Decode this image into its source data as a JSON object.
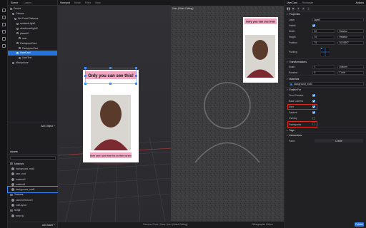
{
  "rail": {
    "icons": [
      "scene-icon",
      "layers-icon",
      "camera-icon",
      "script-icon",
      "asset-icon",
      "settings-icon"
    ]
  },
  "scene_panel": {
    "tabs": [
      "Scene",
      "Layers"
    ],
    "tree": [
      "Device",
      "Camera",
      "Set Focal Distance",
      "ambientLight0",
      "directionalLight0",
      "planeA0",
      "user",
      "ParticipantCard",
      "ParticipantText",
      "UserCard",
      "UserText",
      "Microphone"
    ],
    "selected_index": 9,
    "add_object_label": "Add Object +"
  },
  "assets": {
    "title": "Assets",
    "items": [
      {
        "label": "Materials",
        "kind": "group"
      },
      {
        "label": "background_mat1",
        "kind": "material"
      },
      {
        "label": "user_mat",
        "kind": "material"
      },
      {
        "label": "material0",
        "kind": "material"
      },
      {
        "label": "material1",
        "kind": "material"
      },
      {
        "label": "background_mat0",
        "kind": "material",
        "highlighted": true
      },
      {
        "label": "Textures",
        "kind": "group"
      },
      {
        "label": "cameraTexture0",
        "kind": "texture"
      },
      {
        "label": "nullLayout",
        "kind": "texture"
      },
      {
        "label": "Script",
        "kind": "group"
      },
      {
        "label": "script.js",
        "kind": "script"
      }
    ],
    "add_asset_label": "Add Asset +"
  },
  "viewport": {
    "tabs": [
      "Viewport",
      "Mode",
      "Filter",
      "View"
    ],
    "card_top_text": "Only you can see this!",
    "card_bottom_text": "Both users can view this on their screen"
  },
  "camera_view": {
    "title": "User (Video Calling)",
    "card_text": "Only you can see this!",
    "footer_left": "Camera: Front | View: User (Video Calling)",
    "footer_right": "Orthographic 100cm"
  },
  "inspector": {
    "title": "UserCard",
    "subtitle": "— Rectangle",
    "actions_label": "Actions",
    "sections": {
      "properties": "Properties",
      "transformations": "Transformations",
      "materials": "Materials",
      "enable_for": "Enable For",
      "tags": "Tags",
      "interactions": "Interactions"
    },
    "properties": [
      {
        "label": "Layer",
        "value": "layer0"
      },
      {
        "label": "Visible",
        "value": ""
      },
      {
        "label": "Width",
        "value": "92",
        "unit": "Relative"
      },
      {
        "label": "Height",
        "value": "70",
        "unit": "Relative"
      },
      {
        "label": "Position",
        "value": "74",
        "unit": "16.08397"
      },
      {
        "label": "Pivoting",
        "value": ""
      }
    ],
    "transformations": [
      {
        "label": "Scale",
        "value": "1",
        "unit": "Uniform"
      },
      {
        "label": "Rotation",
        "value": "0",
        "unit": "Z Axis"
      }
    ],
    "material_value": "background_mat0",
    "enable_for": [
      {
        "label": "Front Camera",
        "checked": true,
        "highlighted": false
      },
      {
        "label": "Back Camera",
        "checked": true,
        "highlighted": false
      },
      {
        "label": "User",
        "checked": true,
        "highlighted": true
      },
      {
        "label": "Capture",
        "checked": true,
        "highlighted": false
      },
      {
        "label": "Overlay",
        "checked": false,
        "highlighted": false
      },
      {
        "label": "Participants",
        "checked": false,
        "highlighted": true
      }
    ],
    "interaction_label": "Patch",
    "create_label": "Create",
    "publish_label": "Publish"
  },
  "colors": {
    "accent": "#2f7be0",
    "highlight_box": "#e0271b",
    "card_banner": "#f1a7c2"
  }
}
